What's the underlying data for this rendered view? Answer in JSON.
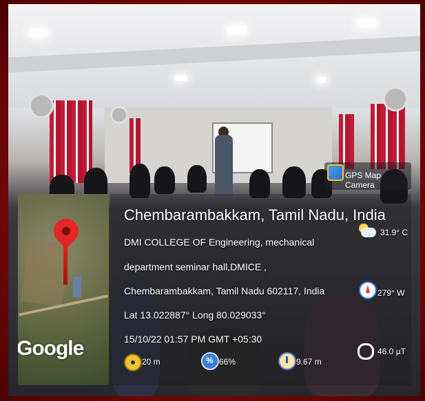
{
  "overlay": {
    "badge": {
      "label": "GPS Map Camera",
      "icon": "gps-map-camera-icon"
    },
    "map": {
      "logo_text": "Google",
      "pin_icon": "location-pin-icon",
      "pin_color": "#e32626"
    },
    "location_title": "Chembarambakkam, Tamil Nadu, India",
    "address_lines": [
      "DMI COLLEGE OF Engineering, mechanical",
      "department seminar hall,DMICE ,",
      "Chembarambakkam, Tamil Nadu 602117, India"
    ],
    "coordinates": "Lat 13.022887° Long 80.029033°",
    "datetime": "15/10/22 01:57 PM GMT +05:30",
    "side_readings": {
      "temperature": "31.9° C",
      "heading": "279° W",
      "magnetic_field": "46.0 µT"
    },
    "bottom_readings": {
      "altitude": "20 m",
      "humidity": "66%",
      "pressure": "9.67 m"
    }
  },
  "colors": {
    "frame": "#8a0b0b",
    "accent_blue": "#2d7bd9"
  }
}
